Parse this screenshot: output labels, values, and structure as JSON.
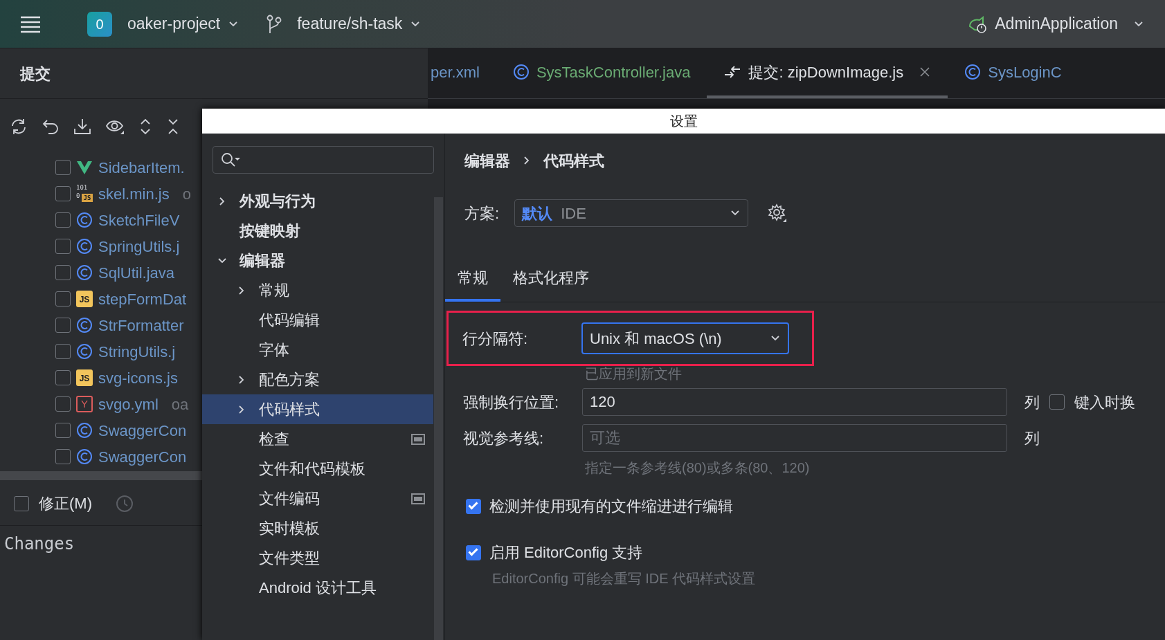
{
  "toolbar": {
    "project_badge": "0",
    "project": "oaker-project",
    "branch": "feature/sh-task",
    "run_config": "AdminApplication"
  },
  "commit_panel": {
    "title": "提交",
    "files": [
      {
        "name": "SidebarItem.",
        "kind": "vue",
        "checked": false
      },
      {
        "name": "skel.min.js",
        "kind": "binary",
        "icon_bits": [
          "101",
          "0"
        ],
        "icon_label": "JS",
        "suffix": "o",
        "checked": false
      },
      {
        "name": "SketchFileV",
        "kind": "class",
        "checked": false
      },
      {
        "name": "SpringUtils.j",
        "kind": "class",
        "checked": false
      },
      {
        "name": "SqlUtil.java",
        "kind": "class",
        "checked": false
      },
      {
        "name": "stepFormDat",
        "kind": "js",
        "icon_label": "JS",
        "checked": false
      },
      {
        "name": "StrFormatter",
        "kind": "class",
        "checked": false
      },
      {
        "name": "StringUtils.j",
        "kind": "class",
        "checked": false
      },
      {
        "name": "svg-icons.js",
        "kind": "js",
        "icon_label": "JS",
        "checked": false
      },
      {
        "name": "svgo.yml",
        "kind": "yaml",
        "icon_label": "Y",
        "suffix": "oa",
        "checked": false
      },
      {
        "name": "SwaggerCon",
        "kind": "class",
        "checked": false
      },
      {
        "name": "SwaggerCon",
        "kind": "class",
        "checked": false
      }
    ],
    "amend": {
      "label": "修正(M)",
      "checked": false
    },
    "message": "Changes"
  },
  "editor_tabs": [
    {
      "label": "per.xml",
      "kind": "plain",
      "color": "#6b95c7",
      "selected": false
    },
    {
      "label": "SysTaskController.java",
      "kind": "class",
      "color": "#6aab73",
      "selected": false
    },
    {
      "label": "提交: zipDownImage.js",
      "kind": "diff",
      "color": "#dfe1e5",
      "selected": true
    },
    {
      "label": "SysLoginC",
      "kind": "class",
      "color": "#6b95c7",
      "selected": false
    }
  ],
  "settings_dialog": {
    "title": "设置",
    "tree": [
      {
        "label": "外观与行为",
        "expanded": false,
        "selected": false
      },
      {
        "label": "按键映射",
        "selected": false
      },
      {
        "label": "编辑器",
        "expanded": true,
        "selected": false,
        "children": [
          {
            "label": "常规",
            "expanded": false,
            "selected": false
          },
          {
            "label": "代码编辑",
            "selected": false
          },
          {
            "label": "字体",
            "selected": false
          },
          {
            "label": "配色方案",
            "expanded": false,
            "selected": false
          },
          {
            "label": "代码样式",
            "expanded": false,
            "selected": true
          },
          {
            "label": "检查",
            "project_scope": true,
            "selected": false
          },
          {
            "label": "文件和代码模板",
            "selected": false
          },
          {
            "label": "文件编码",
            "project_scope": true,
            "selected": false
          },
          {
            "label": "实时模板",
            "selected": false
          },
          {
            "label": "文件类型",
            "selected": false
          },
          {
            "label": "Android 设计工具",
            "selected": false
          }
        ]
      }
    ],
    "breadcrumb": [
      "编辑器",
      "代码样式"
    ],
    "scheme": {
      "label": "方案:",
      "value": "默认",
      "scope": "IDE"
    },
    "tabs": [
      {
        "label": "常规",
        "selected": true
      },
      {
        "label": "格式化程序",
        "selected": false
      }
    ],
    "fields": [
      {
        "kind": "select",
        "label": "行分隔符:",
        "value": "Unix 和 macOS (\\n)",
        "highlighted": true,
        "hint": "已应用到新文件"
      },
      {
        "kind": "text",
        "label": "强制换行位置:",
        "value": "120",
        "unit": "列",
        "option": {
          "label": "键入时换",
          "checked": false
        }
      },
      {
        "kind": "text",
        "label": "视觉参考线:",
        "placeholder": "可选",
        "unit": "列",
        "hint": "指定一条参考线(80)或多条(80、120)"
      },
      {
        "kind": "checkbox",
        "label": "检测并使用现有的文件缩进进行编辑",
        "checked": true
      },
      {
        "kind": "checkbox",
        "label": "启用 EditorConfig 支持",
        "checked": true,
        "hint": "EditorConfig 可能会重写 IDE 代码样式设置"
      }
    ]
  }
}
